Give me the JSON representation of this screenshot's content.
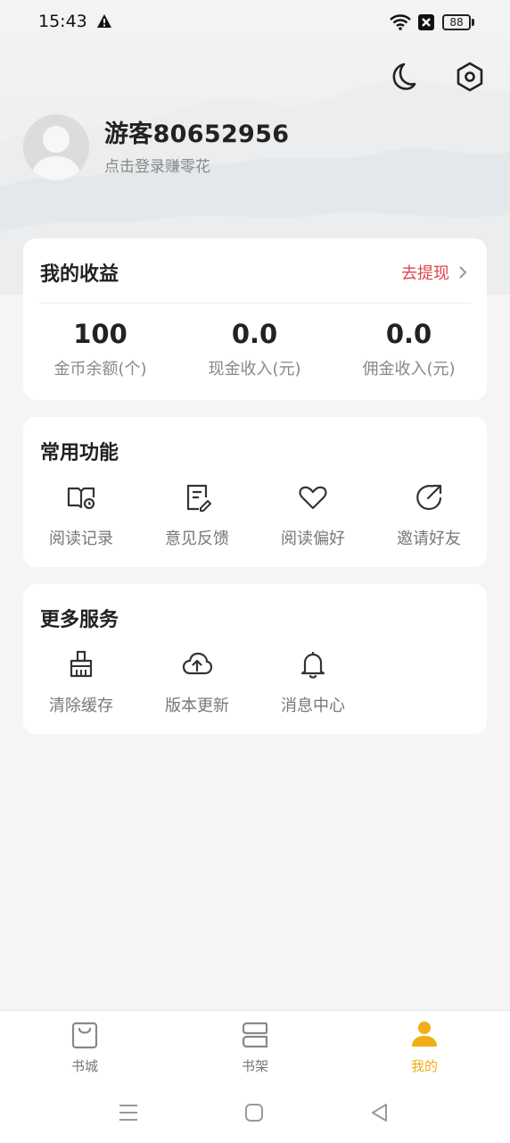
{
  "status_bar": {
    "time": "15:43",
    "battery": "88"
  },
  "profile": {
    "username": "游客80652956",
    "login_hint": "点击登录赚零花"
  },
  "earnings": {
    "title": "我的收益",
    "withdraw_label": "去提现",
    "stats": [
      {
        "value": "100",
        "label": "金币余额(个)"
      },
      {
        "value": "0.0",
        "label": "现金收入(元)"
      },
      {
        "value": "0.0",
        "label": "佣金收入(元)"
      }
    ]
  },
  "common_functions": {
    "title": "常用功能",
    "items": [
      {
        "label": "阅读记录",
        "icon": "reading-history-icon"
      },
      {
        "label": "意见反馈",
        "icon": "feedback-icon"
      },
      {
        "label": "阅读偏好",
        "icon": "heart-icon"
      },
      {
        "label": "邀请好友",
        "icon": "share-icon"
      }
    ]
  },
  "more_services": {
    "title": "更多服务",
    "items": [
      {
        "label": "清除缓存",
        "icon": "broom-icon"
      },
      {
        "label": "版本更新",
        "icon": "cloud-upload-icon"
      },
      {
        "label": "消息中心",
        "icon": "bell-icon"
      }
    ]
  },
  "bottom_nav": {
    "items": [
      {
        "label": "书城",
        "icon": "bag-icon"
      },
      {
        "label": "书架",
        "icon": "bookshelf-icon"
      },
      {
        "label": "我的",
        "icon": "person-icon",
        "active": true
      }
    ]
  },
  "colors": {
    "accent": "#f2ae14",
    "withdraw": "#e0454c",
    "background": "#f5f5f5"
  }
}
